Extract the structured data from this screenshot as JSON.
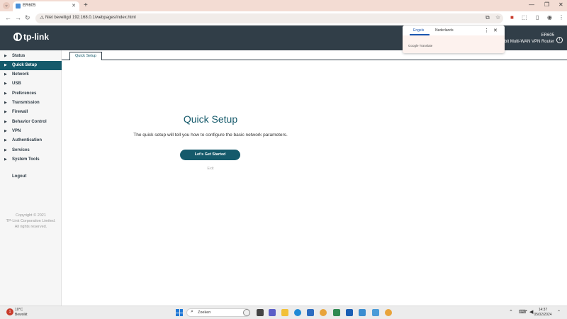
{
  "browser": {
    "tab_title": "ER605",
    "tab_close": "✕",
    "new_tab": "+",
    "security_label": "Niet beveiligd",
    "url": "192.168.0.1/webpages/index.html"
  },
  "router": {
    "brand": "tp-link",
    "model": "ER605",
    "model_desc": "Gigabit Multi-WAN VPN Router"
  },
  "translate": {
    "lang_from": "Engels",
    "lang_to": "Nederlands",
    "brand": "Google Translate"
  },
  "sidebar": {
    "items": [
      {
        "label": "Status"
      },
      {
        "label": "Quick Setup",
        "active": true
      },
      {
        "label": "Network"
      },
      {
        "label": "USB"
      },
      {
        "label": "Preferences"
      },
      {
        "label": "Transmission"
      },
      {
        "label": "Firewall"
      },
      {
        "label": "Behavior Control"
      },
      {
        "label": "VPN"
      },
      {
        "label": "Authentication"
      },
      {
        "label": "Services"
      },
      {
        "label": "System Tools"
      }
    ],
    "logout": "Logout",
    "copyright_lines": [
      "Copyright © 2021",
      "TP-Link Corporation Limited.",
      "All rights reserved."
    ]
  },
  "main": {
    "tab_label": "Quick Setup",
    "title": "Quick Setup",
    "description": "The quick setup will tell you how to configure the basic network parameters.",
    "start_button": "Let's Get Started",
    "exit_link": "Exit"
  },
  "taskbar": {
    "weather_temp": "10°C",
    "weather_cond": "Bewolkt",
    "weather_badge": "1",
    "search_placeholder": "Zoeken",
    "time": "14:37",
    "date": "05/02/2024"
  },
  "colors": {
    "header": "#313e48",
    "accent": "#155a6b",
    "tab_strip": "#f3dcd3"
  }
}
